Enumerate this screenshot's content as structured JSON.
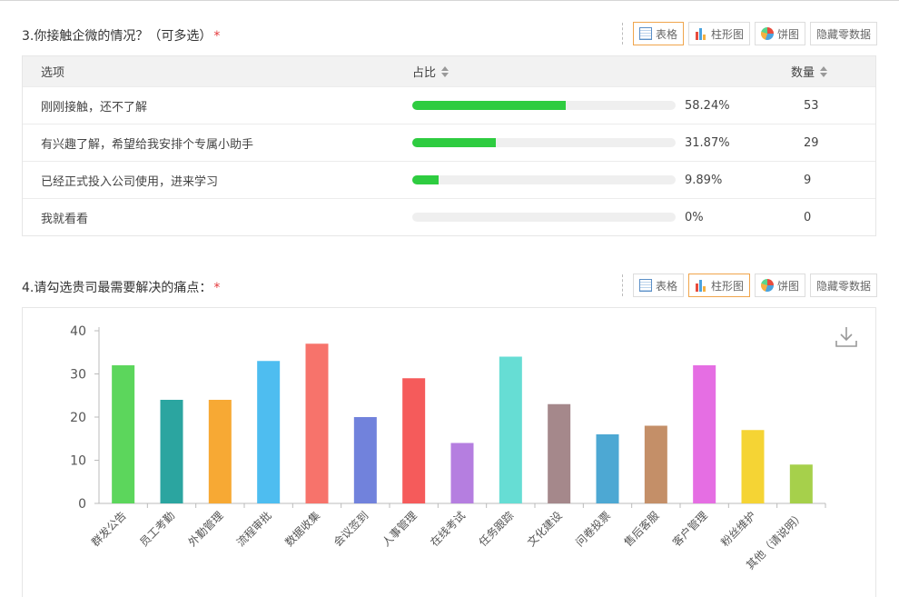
{
  "q3": {
    "title": "3.你接触企微的情况？（可多选）",
    "required_mark": "*",
    "buttons": {
      "table": "表格",
      "bar": "柱形图",
      "pie": "饼图",
      "hide_zero": "隐藏零数据"
    },
    "active_view": "table",
    "columns": {
      "option": "选项",
      "ratio": "占比",
      "count": "数量"
    },
    "rows": [
      {
        "option": "刚刚接触，还不了解",
        "percent": 58.24,
        "percent_text": "58.24%",
        "count": "53"
      },
      {
        "option": "有兴趣了解，希望给我安排个专属小助手",
        "percent": 31.87,
        "percent_text": "31.87%",
        "count": "29"
      },
      {
        "option": "已经正式投入公司使用，进来学习",
        "percent": 9.89,
        "percent_text": "9.89%",
        "count": "9"
      },
      {
        "option": "我就看看",
        "percent": 0,
        "percent_text": "0%",
        "count": "0"
      }
    ],
    "bar_color": "#2ecc40"
  },
  "q4": {
    "title": "4.请勾选贵司最需要解决的痛点：",
    "required_mark": "*",
    "buttons": {
      "table": "表格",
      "bar": "柱形图",
      "pie": "饼图",
      "hide_zero": "隐藏零数据"
    },
    "active_view": "bar",
    "download_icon": "download-icon"
  },
  "chart_data": {
    "type": "bar",
    "categories": [
      "群发公告",
      "员工考勤",
      "外勤管理",
      "流程审批",
      "数据收集",
      "会议签到",
      "人事管理",
      "在线考试",
      "任务跟踪",
      "文化建设",
      "问卷投票",
      "售后客服",
      "客户管理",
      "粉丝维护",
      "其他（请说明）"
    ],
    "values": [
      32,
      24,
      24,
      33,
      37,
      20,
      29,
      14,
      34,
      23,
      16,
      18,
      32,
      17,
      9
    ],
    "colors": [
      "#5cd65c",
      "#2ba5a0",
      "#f7a934",
      "#4ebdf0",
      "#f7736b",
      "#7182dc",
      "#f55b5b",
      "#b57ee0",
      "#66ddd4",
      "#a5888b",
      "#4da8d3",
      "#c48f68",
      "#e56ee3",
      "#f5d434",
      "#a6d04b"
    ],
    "yticks": [
      0,
      10,
      20,
      30,
      40
    ],
    "ylim": [
      0,
      40
    ],
    "xlabel": "",
    "ylabel": ""
  }
}
